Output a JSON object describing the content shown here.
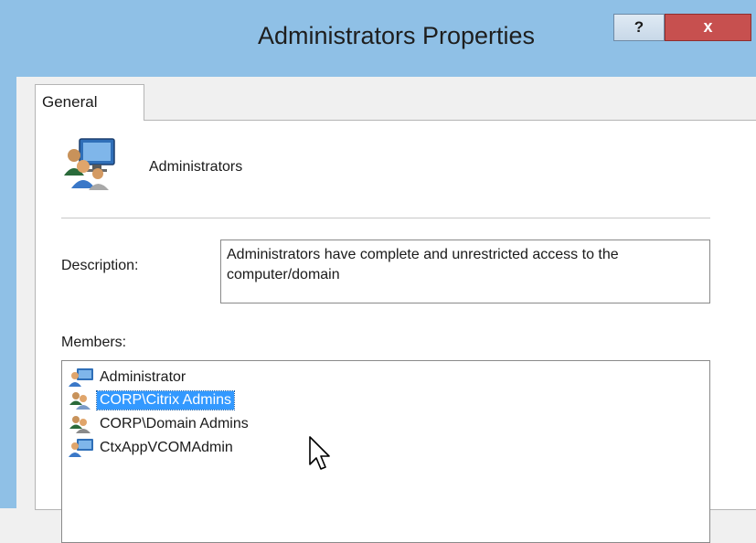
{
  "window": {
    "title": "Administrators Properties",
    "help_label": "?",
    "close_label": "x"
  },
  "tabs": [
    {
      "label": "General"
    }
  ],
  "general": {
    "group_icon": "users-group-icon",
    "group_name": "Administrators",
    "description_label": "Description:",
    "description_value": "Administrators have complete and unrestricted access to the computer/domain",
    "members_label": "Members:",
    "members": [
      {
        "name": "Administrator",
        "icon": "user-icon",
        "selected": false
      },
      {
        "name": "CORP\\Citrix Admins",
        "icon": "group-icon",
        "selected": true
      },
      {
        "name": "CORP\\Domain Admins",
        "icon": "group-icon",
        "selected": false
      },
      {
        "name": "CtxAppVCOMAdmin",
        "icon": "user-icon",
        "selected": false
      }
    ]
  },
  "colors": {
    "selection": "#3399ff",
    "close_button": "#c7504f",
    "frame": "#8fc0e6"
  }
}
